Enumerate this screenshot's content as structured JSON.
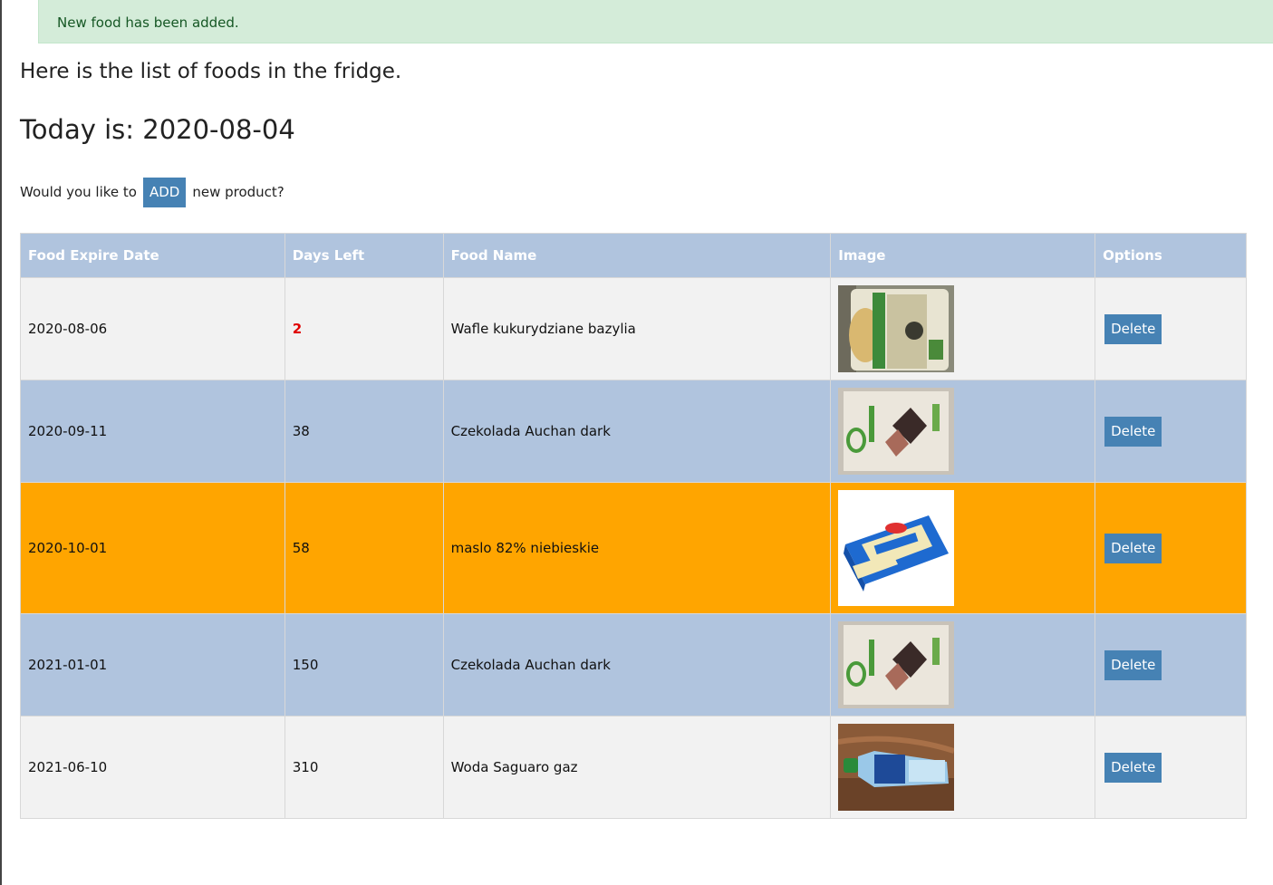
{
  "alert": {
    "message": "New food has been added."
  },
  "intro": "Here is the list of foods in the fridge.",
  "today": "Today is: 2020-08-04",
  "add_prompt": {
    "before": "Would you like to",
    "button": "ADD",
    "after": "new product?"
  },
  "table": {
    "headers": [
      "Food Expire Date",
      "Days Left",
      "Food Name",
      "Image",
      "Options"
    ],
    "delete_label": "Delete",
    "rows": [
      {
        "date": "2020-08-06",
        "days": "2",
        "name": "Wafle kukurydziane bazylia",
        "image": "rice-cakes-package"
      },
      {
        "date": "2020-09-11",
        "days": "38",
        "name": "Czekolada Auchan dark",
        "image": "dark-chocolate-bar"
      },
      {
        "date": "2020-10-01",
        "days": "58",
        "name": "maslo 82% niebieskie",
        "image": "butter-package"
      },
      {
        "date": "2021-01-01",
        "days": "150",
        "name": "Czekolada Auchan dark",
        "image": "dark-chocolate-bar"
      },
      {
        "date": "2021-06-10",
        "days": "310",
        "name": "Woda Saguaro gaz",
        "image": "water-bottle"
      }
    ]
  },
  "colors": {
    "header": "#b0c4de",
    "row_gray": "#f2f2f2",
    "row_blue": "#b0c4de",
    "row_orange": "#ffa500",
    "button": "#4682b4",
    "alert_bg": "#d4ecd9",
    "urgent": "#e00000"
  }
}
